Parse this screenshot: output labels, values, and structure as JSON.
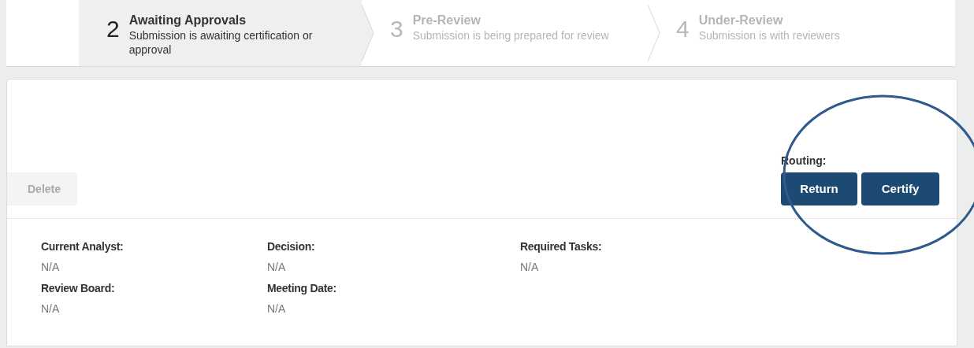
{
  "steps": [
    {
      "number": "2",
      "title": "Awaiting Approvals",
      "description": "Submission is awaiting certification or approval",
      "selected": true
    },
    {
      "number": "3",
      "title": "Pre-Review",
      "description": "Submission is being prepared for review",
      "selected": false
    },
    {
      "number": "4",
      "title": "Under-Review",
      "description": "Submission is with reviewers",
      "selected": false
    }
  ],
  "actions": [
    {
      "label": "Delete",
      "disabled": true
    }
  ],
  "routing": {
    "label": "Routing:",
    "buttons": [
      {
        "label": "Return",
        "disabled": false
      },
      {
        "label": "Certify",
        "disabled": false
      }
    ]
  },
  "fields": [
    {
      "label": "Current Analyst:",
      "value": "N/A"
    },
    {
      "label": "Decision:",
      "value": "N/A"
    },
    {
      "label": "Required Tasks:",
      "value": "N/A"
    },
    {
      "label": "Review Board:",
      "value": "N/A"
    },
    {
      "label": "Meeting Date:",
      "value": "N/A"
    }
  ]
}
